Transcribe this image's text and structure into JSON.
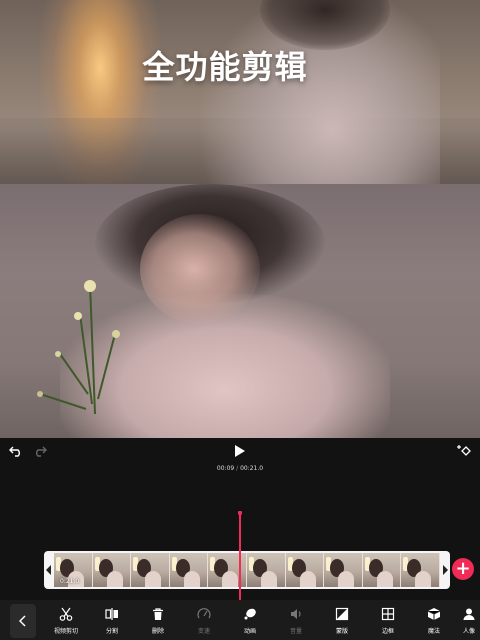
{
  "hero": {
    "title": "全功能剪辑"
  },
  "timeline": {
    "current_time": "00:09",
    "separator": " / ",
    "total_time": "00:21.0",
    "clip_duration": "0:21.0"
  },
  "toolbar": {
    "items": [
      {
        "label": "视频剪切",
        "icon": "scissors-icon",
        "enabled": true
      },
      {
        "label": "分割",
        "icon": "split-icon",
        "enabled": true
      },
      {
        "label": "删除",
        "icon": "trash-icon",
        "enabled": true
      },
      {
        "label": "变速",
        "icon": "speed-icon",
        "enabled": false
      },
      {
        "label": "动画",
        "icon": "animation-icon",
        "enabled": true
      },
      {
        "label": "音量",
        "icon": "volume-icon",
        "enabled": false
      },
      {
        "label": "蒙版",
        "icon": "mask-icon",
        "enabled": true
      },
      {
        "label": "边框",
        "icon": "border-icon",
        "enabled": true
      },
      {
        "label": "魔法",
        "icon": "magic-cube-icon",
        "enabled": true
      },
      {
        "label": "人像",
        "icon": "portrait-icon",
        "enabled": true
      }
    ]
  },
  "colors": {
    "accent": "#f02b56",
    "background": "#121212",
    "toolbar": "#1b1b1b"
  }
}
